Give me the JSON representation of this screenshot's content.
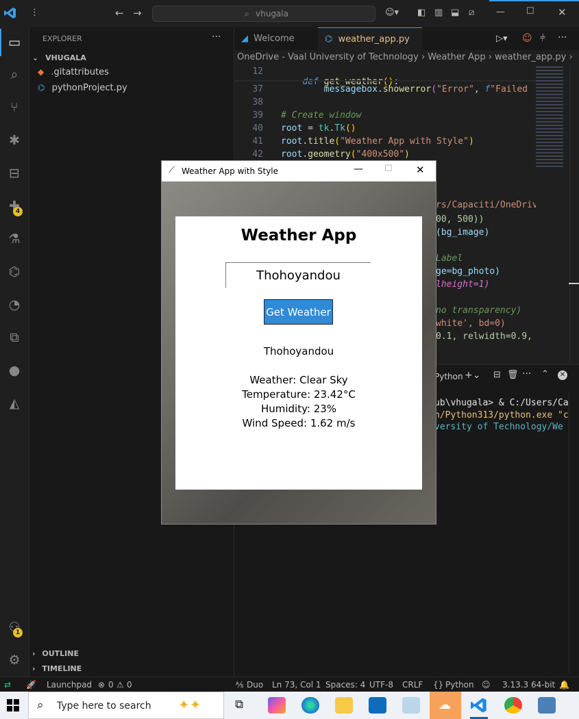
{
  "titlebar": {
    "search_text": "vhugala"
  },
  "sidebar": {
    "header": "EXPLORER",
    "folder": "VHUGALA",
    "files": [
      {
        "name": ".gitattributes"
      },
      {
        "name": "pythonProject.py"
      }
    ],
    "outline": "OUTLINE",
    "timeline": "TIMELINE",
    "badges": {
      "extensions": "4",
      "accounts": "1"
    }
  },
  "tabs": [
    {
      "label": "Welcome"
    },
    {
      "label": "weather_app.py"
    }
  ],
  "breadcrumb": "OneDrive - Vaal University of Technology  ›  Weather App  ›  weather_app.py  › ...",
  "code": [
    {
      "ln": "12",
      "text": "def get_weather():"
    },
    {
      "ln": "37",
      "text": "        messagebox.showerror(\"Error\", f\"Failed"
    },
    {
      "ln": "38",
      "text": ""
    },
    {
      "ln": "39",
      "text": "# Create window"
    },
    {
      "ln": "40",
      "text": "root = tk.Tk()"
    },
    {
      "ln": "41",
      "text": "root.title(\"Weather App with Style\")"
    },
    {
      "ln": "42",
      "text": "root.geometry(\"400x500\")"
    }
  ],
  "code_hidden_fragments": [
    "rs/Capaciti/OneDriv",
    "00, 500))",
    "(bg_image)",
    "Label",
    "ge=bg_photo)",
    "lheight=1)",
    "no transparency)",
    "white', bd=0)",
    "0.1, relwidth=0.9,"
  ],
  "terminal": {
    "title": "Python",
    "lines": [
      "ub\\vhugala> & C:/Users/Ca",
      "n/Python313/python.exe \"c",
      "versity of Technology/We"
    ]
  },
  "status": {
    "launchpad": "Launchpad",
    "problems": "0",
    "warnings": "0",
    "duo": "Duo",
    "position": "Ln 73, Col 1",
    "spaces": "Spaces: 4",
    "encoding": "UTF-8",
    "eol": "CRLF",
    "language": "Python",
    "interpreter": "3.13.3 64-bit"
  },
  "taskbar": {
    "search_placeholder": "Type here to search"
  },
  "weather_window": {
    "title": "Weather App with Style",
    "heading": "Weather App",
    "city_value": "Thohoyandou",
    "button_label": "Get Weather",
    "result_city": "Thohoyandou",
    "weather": "Weather: Clear Sky",
    "temperature": "Temperature: 23.42°C",
    "humidity": "Humidity: 23%",
    "wind": "Wind Speed: 1.62 m/s"
  },
  "colors": {
    "accent": "#3a9ee8",
    "tab_modified": "#e2c08d",
    "button_bg": "#2f8ad8",
    "badge": "#e4c027"
  }
}
